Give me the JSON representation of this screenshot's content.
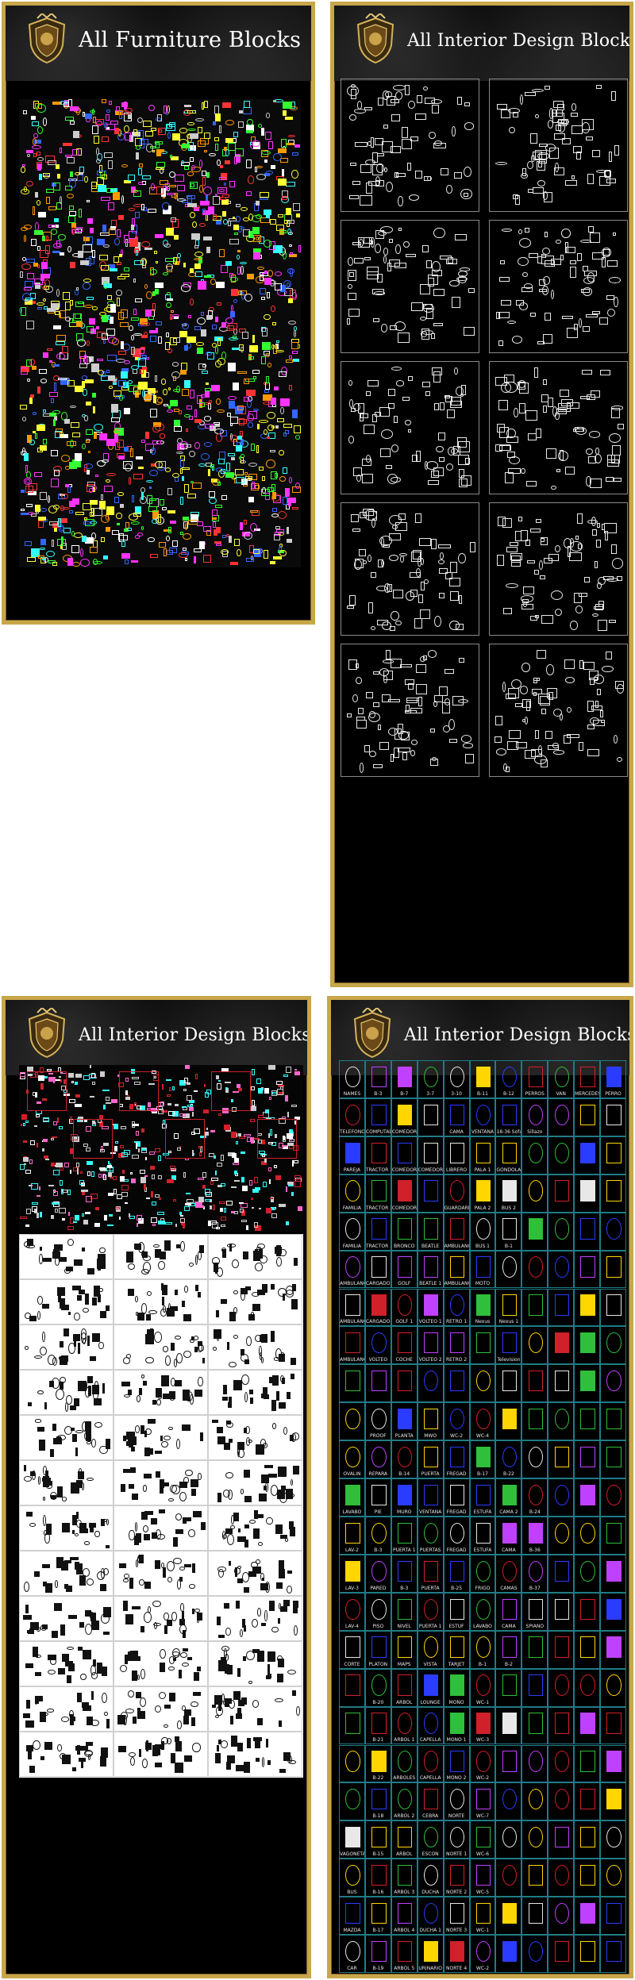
{
  "panels": {
    "furniture": {
      "title": "All Furniture Blocks"
    },
    "interior_top": {
      "title": "All Interior Design Blocks"
    },
    "interior_bottom_left": {
      "title": "All Interior Design Blocks"
    },
    "interior_bottom_right": {
      "title": "All Interior Design Blocks"
    }
  },
  "colors": {
    "frame_gold": "#c8a64a",
    "panel_black": "#000000",
    "cad_cyan": "#1f7c86",
    "cad_red": "#d0202a"
  },
  "block_grid": {
    "labels": [
      "NAMES",
      "B-3",
      "B-7",
      "3-7",
      "3-10",
      "B-11",
      "B-12",
      "PERROS",
      "VAN",
      "MERCEDES",
      "PERRO",
      "TELEFONO",
      "COMPUTADORA",
      "COMEDOR",
      "",
      "CAMA",
      "VENTANA",
      "18-36 Sofa",
      "Sillazo",
      "",
      "",
      "",
      "PAREJA",
      "TRACTOR 1",
      "COMEDOR 1",
      "COMEDOR 2",
      "LIBRERO",
      "PALA 1",
      "GONDOLA",
      "",
      "",
      "",
      "",
      "FAMILIA",
      "TRACTOR 2",
      "COMEDOR 3",
      "",
      "GUARDARROPA",
      "PALA 2",
      "BUS 2",
      "",
      "",
      "",
      "",
      "FAMILIA",
      "TRACTOR 3",
      "BRONCO",
      "BEATLE",
      "AMBULANCIA",
      "BUS 1",
      "B-1",
      "",
      "",
      "",
      "",
      "AMBULANCIA",
      "CARGADOR",
      "GOLF",
      "BEATLE 1",
      "AMBULANCIA",
      "MOTO",
      "",
      "",
      "",
      "",
      "",
      "AMBULANCIA",
      "CARGADOR",
      "GOLF 1",
      "VOLTEO 1",
      "RETRO 1",
      "Nexus",
      "Nexus 1",
      "",
      "",
      "",
      "",
      "AMBULANCIA",
      "VOLTEO",
      "COCHE",
      "VOLTEO 2",
      "RETRO 2",
      "",
      "Television",
      "",
      "",
      "",
      "",
      "",
      "",
      "",
      "",
      "",
      "",
      "",
      "",
      "",
      "",
      "",
      "",
      "PROOF",
      "PLANTA",
      "MWO",
      "WC-2",
      "WC-4",
      "",
      "",
      "",
      "",
      "",
      "OVALIN",
      "REPARA",
      "B-14",
      "PUERTA",
      "FREGAD",
      "B-17",
      "B-22",
      "",
      "",
      "",
      "",
      "LAVABO",
      "PIE",
      "MURO",
      "VENTANA",
      "FREGAD",
      "ESTUFA",
      "CAMA 2",
      "B-24",
      "",
      "",
      "",
      "LAV-2",
      "B-3",
      "PUERTA 1",
      "PUERTAS",
      "FREGAD",
      "ESTUFA",
      "CAMA",
      "B-36",
      "",
      "",
      "",
      "LAV-3",
      "PARED",
      "B-3",
      "PUERTA",
      "B-25",
      "FRIGO",
      "CAMAS",
      "B-37",
      "",
      "",
      "",
      "LAV-4",
      "PISO",
      "NIVEL",
      "PUERTA 1",
      "ESTUF",
      "LAVABO",
      "CAMA",
      "SPIANO",
      "",
      "",
      "",
      "CORTE",
      "PLATON",
      "MAPS",
      "VISTA",
      "TARJET",
      "B-1",
      "B-2",
      "",
      "",
      "",
      "",
      "",
      "B-20",
      "ARBOL",
      "LOUNGE",
      "MONO",
      "WC-1",
      "",
      "",
      "",
      "",
      "",
      "",
      "B-21",
      "ARBOL 1",
      "CAPELLA",
      "MONO 1",
      "WC-3",
      "",
      "",
      "",
      "",
      "",
      "",
      "B-22",
      "ARBOLES",
      "CAPELLA",
      "MONO 2",
      "WC-2",
      "",
      "",
      "",
      "",
      "",
      "",
      "B-18",
      "ARBOL 2",
      "CEBRA",
      "NORTE",
      "WC-7",
      "",
      "",
      "",
      "",
      "",
      "VAGONETA",
      "B-15",
      "ARBOL",
      "ESCON",
      "NORTE 1",
      "WC-6",
      "",
      "",
      "",
      "",
      "",
      "BUS",
      "B-16",
      "ARBOL 3",
      "DUCHA",
      "NORTE 2",
      "WC-5",
      "",
      "",
      "",
      "",
      "",
      "MAZDA",
      "B-17",
      "ARBOL 4",
      "DUCHA 1",
      "NORTE 3",
      "WC-1",
      "",
      "",
      "",
      "",
      "",
      "CAR",
      "B-19",
      "ARBOL 5",
      "URINARIO",
      "NORTE 4",
      "WC-2",
      "",
      "",
      "",
      "",
      ""
    ]
  }
}
